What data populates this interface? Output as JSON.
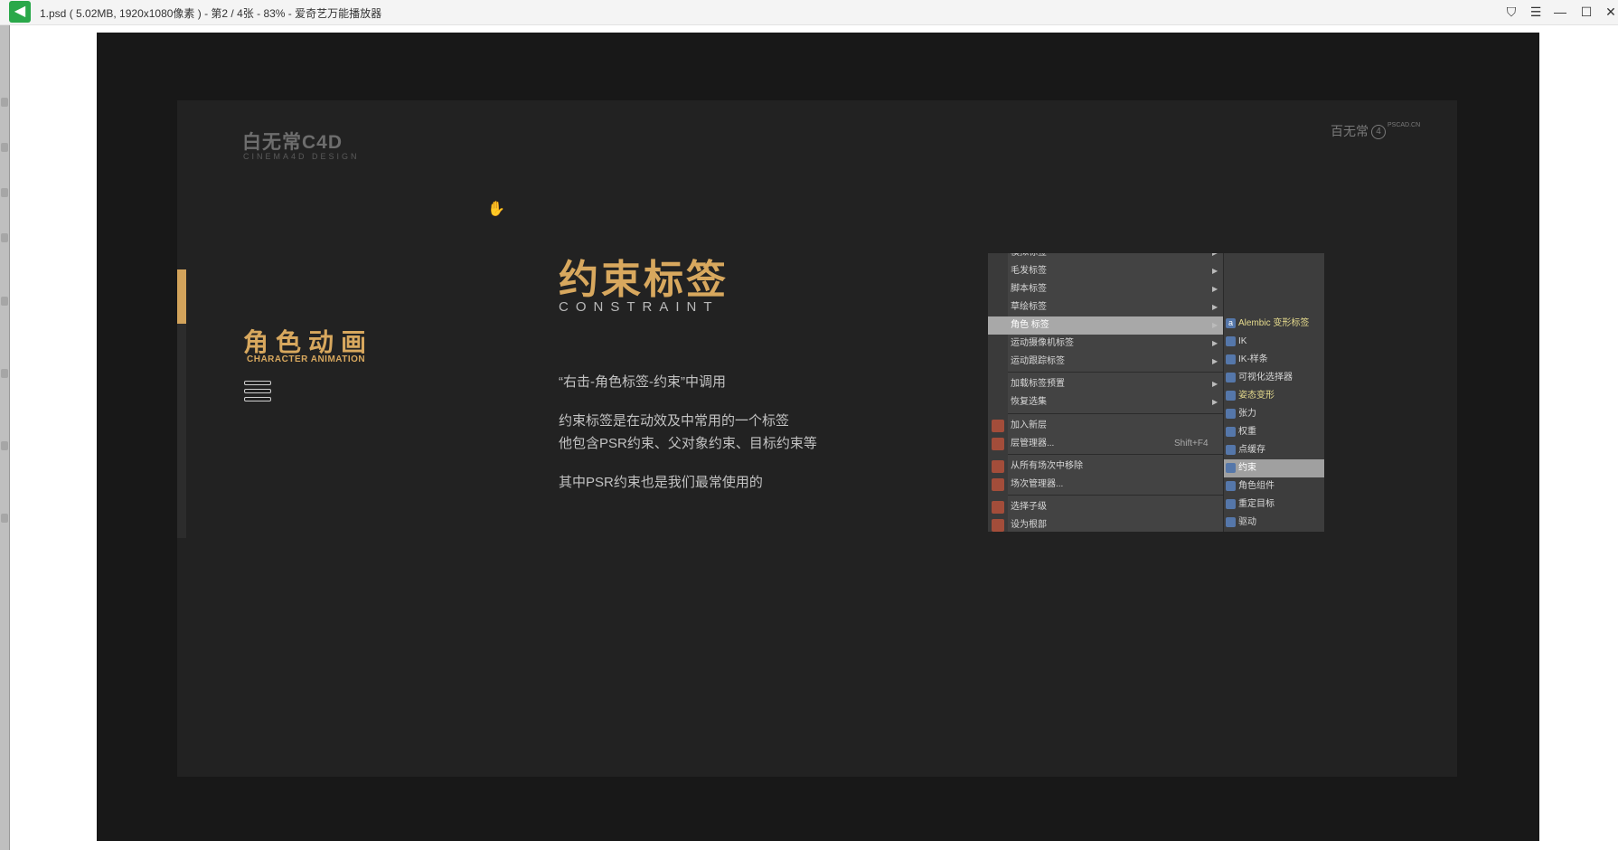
{
  "window": {
    "app_icon": "app-logo-icon",
    "title": "1.psd ( 5.02MB, 1920x1080像素 ) - 第2 / 4张 - 83% - 爱奇艺万能播放器",
    "controls": [
      "shirt-icon",
      "menu-icon",
      "minimize-icon",
      "maximize-icon",
      "close-icon"
    ]
  },
  "slide": {
    "logo_main": "白无常C4D",
    "logo_sub": "CINEMA4D DESIGN",
    "logo_right": "百无常",
    "logo_right_mark": "4",
    "logo_right_small": "PSCAD.CN",
    "section_title_cn": "角色动画",
    "section_title_en": "CHARACTER ANIMATION",
    "heading_cn": "约束标签",
    "heading_en": "CONSTRAINT",
    "body": [
      "“右击-角色标签-约束”中调用",
      "约束标签是在动效及中常用的一个标签",
      "他包含PSR约束、父对象约束、目标约束等",
      "其中PSR约束也是我们最常使用的"
    ],
    "accent_color": "#d8a85e"
  },
  "context_menu": {
    "main_items": [
      {
        "label": "模拟标签",
        "arrow": true
      },
      {
        "label": "毛发标签",
        "arrow": true
      },
      {
        "label": "脚本标签",
        "arrow": true
      },
      {
        "label": "草绘标签",
        "arrow": true
      },
      {
        "label": "角色 标签",
        "arrow": true,
        "selected": true
      },
      {
        "label": "运动摄像机标签",
        "arrow": true
      },
      {
        "label": "运动跟踪标签",
        "arrow": true
      },
      {
        "label": "加载标签预置",
        "arrow": true
      },
      {
        "label": "恢复选集",
        "arrow": true
      },
      {
        "label": "加入新层",
        "icon": true
      },
      {
        "label": "层管理器...",
        "shortcut": "Shift+F4",
        "icon": true
      },
      {
        "label": "从所有场次中移除",
        "icon": true
      },
      {
        "label": "场次管理器...",
        "icon": true
      },
      {
        "label": "选择子级",
        "icon": true
      },
      {
        "label": "设为根部",
        "icon": true
      }
    ],
    "submenu_items": [
      {
        "label": "Alembic 变形标签",
        "highlight": true
      },
      {
        "label": "IK"
      },
      {
        "label": "IK-样条"
      },
      {
        "label": "可视化选择器"
      },
      {
        "label": "姿态变形",
        "highlight": true
      },
      {
        "label": "张力"
      },
      {
        "label": "权重"
      },
      {
        "label": "点缓存"
      },
      {
        "label": "约束",
        "selected": true
      },
      {
        "label": "角色组件"
      },
      {
        "label": "重定目标"
      },
      {
        "label": "驱动"
      }
    ]
  }
}
